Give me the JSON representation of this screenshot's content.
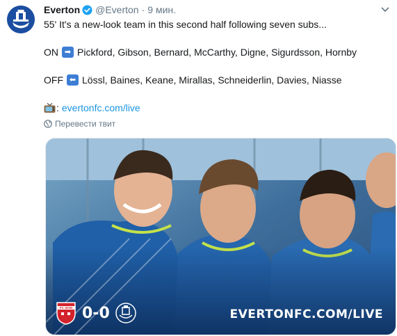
{
  "tweet": {
    "author": {
      "display_name": "Everton",
      "handle": "@Everton",
      "verified": true,
      "avatar_icon": "everton-crest-icon"
    },
    "separator": "·",
    "time": "9 мин.",
    "lines": {
      "l1": "55' It's a new-look team in this second half following seven subs...",
      "on_label": "ON",
      "on_players": "Pickford, Gibson, Bernard, McCarthy, Digne, Sigurdsson, Hornby",
      "off_label": "OFF",
      "off_players": "Lössl, Baines, Keane, Mirallas, Schneiderlin, Davies, Niasse",
      "link_suffix": ":",
      "link": "evertonfc.com/live"
    },
    "translate_label": "Перевести твит",
    "media": {
      "score": "0-0",
      "site": "EVERTONFC.COM/LIVE",
      "home_badge": "FC SION",
      "away_badge": "everton-crest-icon"
    }
  },
  "colors": {
    "link": "#1b95e0",
    "muted": "#657786",
    "everton_blue": "#1b4ea0",
    "emoji_blue": "#3d7ed4",
    "sion_red": "#d3232c"
  }
}
